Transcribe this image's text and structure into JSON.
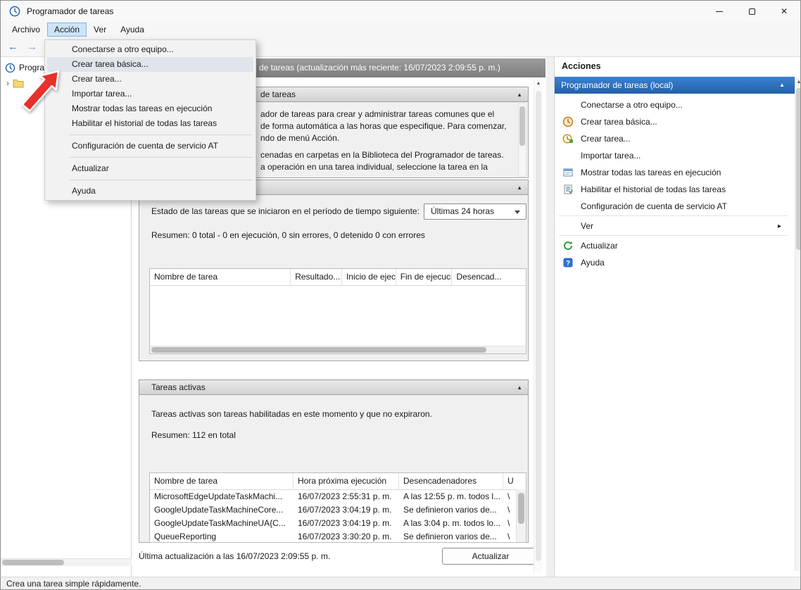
{
  "window": {
    "title": "Programador de tareas",
    "status_bar": "Crea una tarea simple rápidamente."
  },
  "icons": {
    "close": "✕",
    "back": "←",
    "forward": "→",
    "collapse": "▲",
    "scroll_up": "▲",
    "submenu_arrow": "▸",
    "tree_expander": "›"
  },
  "menu_bar": {
    "archivo": "Archivo",
    "accion": "Acción",
    "ver": "Ver",
    "ayuda": "Ayuda"
  },
  "action_menu": {
    "items": [
      "Conectarse a otro equipo...",
      "Crear tarea básica...",
      "Crear tarea...",
      "Importar tarea...",
      "Mostrar todas las tareas en ejecución",
      "Habilitar el historial de todas las tareas",
      "Configuración de cuenta de servicio AT",
      "Actualizar",
      "Ayuda"
    ]
  },
  "tree": {
    "root_label": "Progra"
  },
  "console_header": {
    "text": "de tareas (actualización más reciente: 16/07/2023 2:09:55 p. m.)"
  },
  "overview": {
    "title_fragment": "de tareas",
    "lines": [
      "ador de tareas para crear y administrar tareas comunes que el",
      "de forma automática a las horas que especifique. Para comenzar,",
      "ndo de menú Acción.",
      "cenadas en carpetas en la Biblioteca del Programador de tareas.",
      "a operación en una tarea individual, seleccione la tarea en la"
    ]
  },
  "task_status": {
    "filter_label": "Estado de las tareas que se iniciaron en el período de tiempo siguiente:",
    "filter_value": "Últimas 24 horas",
    "summary": "Resumen: 0 total - 0 en ejecución, 0 sin errores, 0 detenido  0 con errores",
    "columns": [
      "Nombre de tarea",
      "Resultado...",
      "Inicio de ejecu...",
      "Fin de ejecución",
      "Desencad..."
    ]
  },
  "active_tasks": {
    "title": "Tareas activas",
    "description": "Tareas activas son tareas habilitadas en este momento y que no expiraron.",
    "summary": "Resumen: 112 en total",
    "columns": [
      "Nombre de tarea",
      "Hora próxima ejecución",
      "Desencadenadores",
      "U"
    ],
    "rows": [
      [
        "MicrosoftEdgeUpdateTaskMachi...",
        "16/07/2023 2:55:31 p. m.",
        "A las 12:55 p. m. todos l...",
        "\\"
      ],
      [
        "GoogleUpdateTaskMachineCore...",
        "16/07/2023 3:04:19 p. m.",
        "Se definieron varios de...",
        "\\"
      ],
      [
        "GoogleUpdateTaskMachineUA{C...",
        "16/07/2023 3:04:19 p. m.",
        "A las 3:04 p. m. todos lo...",
        "\\"
      ],
      [
        "QueueReporting",
        "16/07/2023 3:30:20 p. m.",
        "Se definieron varios de...",
        "\\"
      ]
    ],
    "footer": "Última actualización a las 16/07/2023 2:09:55 p. m.",
    "refresh_button": "Actualizar"
  },
  "actions_panel": {
    "header": "Acciones",
    "scope": "Programador de tareas (local)",
    "items": [
      "Conectarse a otro equipo...",
      "Crear tarea básica...",
      "Crear tarea...",
      "Importar tarea...",
      "Mostrar todas las tareas en ejecución",
      "Habilitar el historial de todas las tareas",
      "Configuración de cuenta de servicio AT",
      "Ver",
      "Actualizar",
      "Ayuda"
    ]
  }
}
